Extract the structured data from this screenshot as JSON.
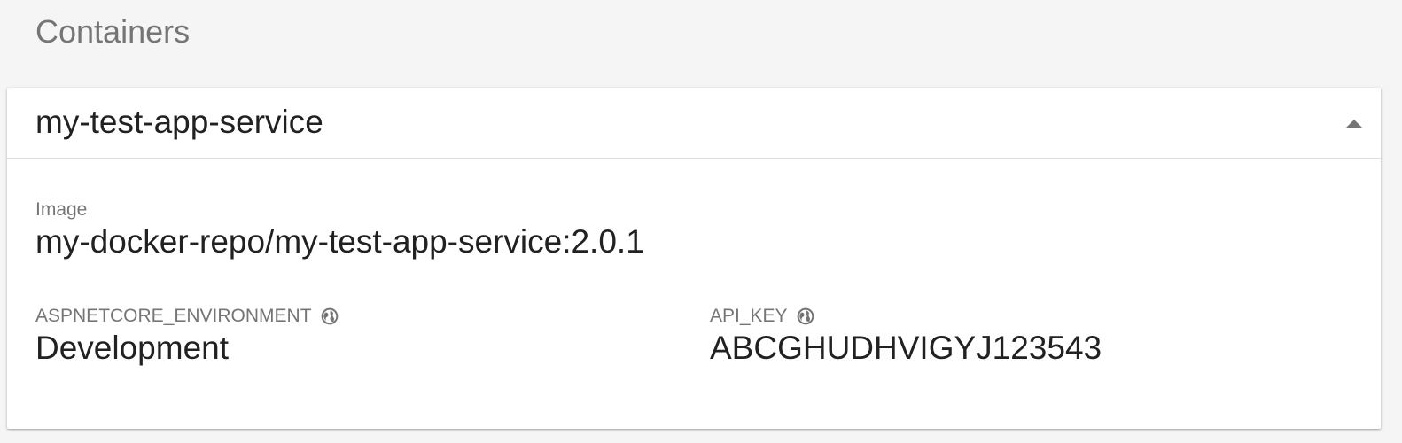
{
  "section": {
    "title": "Containers"
  },
  "container": {
    "name": "my-test-app-service",
    "expanded": true,
    "image_label": "Image",
    "image_value": "my-docker-repo/my-test-app-service:2.0.1",
    "env": [
      {
        "name": "ASPNETCORE_ENVIRONMENT",
        "value": "Development",
        "icon": "globe-icon"
      },
      {
        "name": "API_KEY",
        "value": "ABCGHUDHVIGYJ123543",
        "icon": "globe-icon"
      }
    ]
  },
  "colors": {
    "background": "#f5f5f5",
    "card": "#ffffff",
    "label": "#757575",
    "text": "#212121",
    "icon": "#757575"
  }
}
